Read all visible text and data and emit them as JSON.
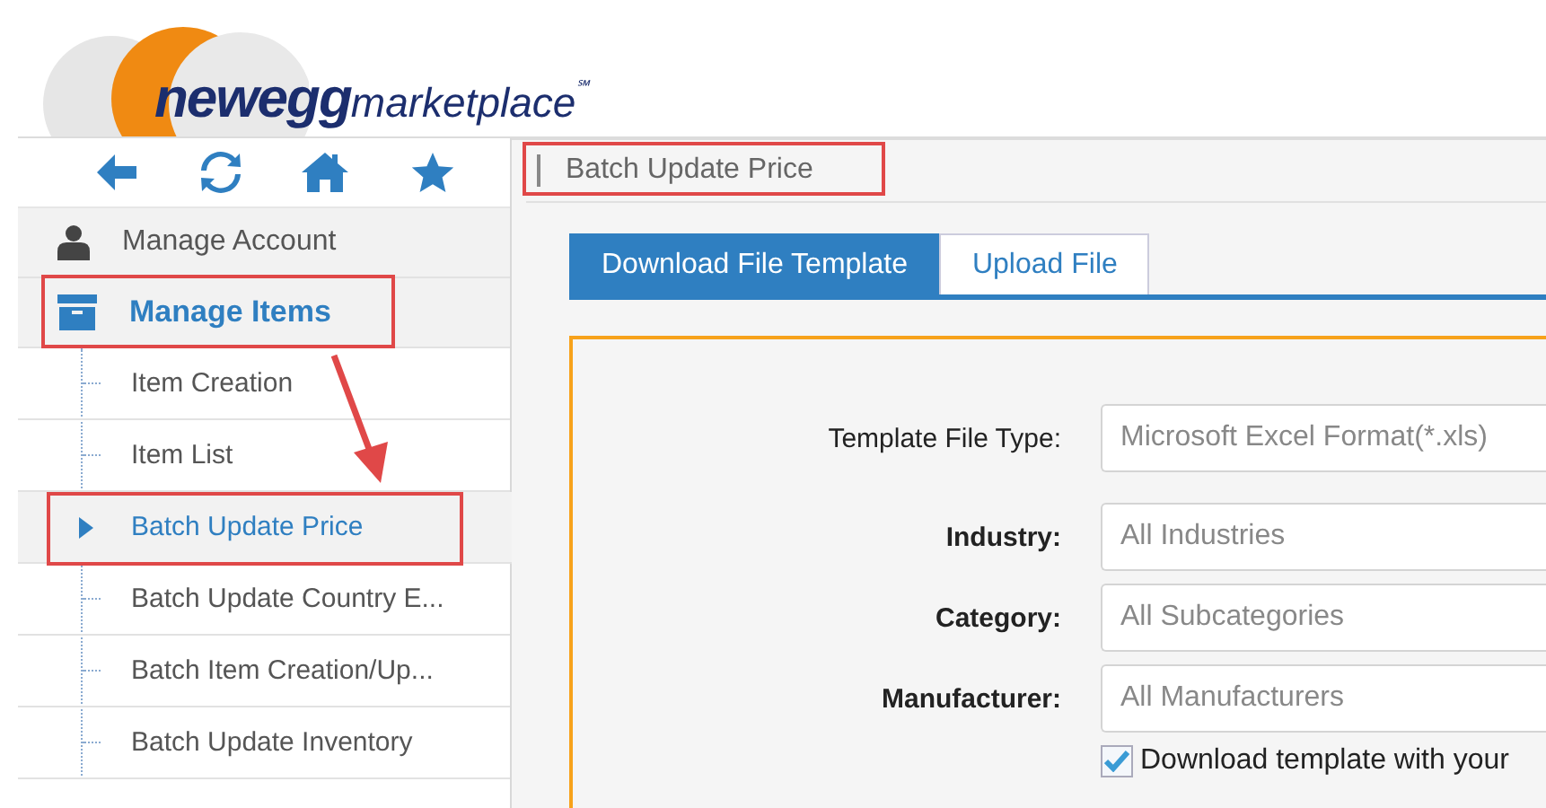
{
  "logo": {
    "brand": "newegg",
    "suffix": "marketplace",
    "mark": "℠"
  },
  "nav_icons": [
    {
      "kind": "back"
    },
    {
      "kind": "refresh"
    },
    {
      "kind": "home"
    },
    {
      "kind": "favorite"
    }
  ],
  "sidebar": {
    "items": [
      {
        "label": "Manage Account",
        "kind": "account",
        "expanded": false,
        "annotated": false
      },
      {
        "label": "Manage Items",
        "kind": "items",
        "expanded": true,
        "annotated": true,
        "children": [
          {
            "label": "Item Creation",
            "selected": false,
            "annotated": false
          },
          {
            "label": "Item List",
            "selected": false,
            "annotated": false
          },
          {
            "label": "Batch Update Price",
            "selected": true,
            "annotated": true
          },
          {
            "label": "Batch Update Country E...",
            "selected": false,
            "annotated": false
          },
          {
            "label": "Batch Item Creation/Up...",
            "selected": false,
            "annotated": false
          },
          {
            "label": "Batch Update Inventory",
            "selected": false,
            "annotated": false
          }
        ]
      }
    ]
  },
  "annotation_arrow": true,
  "breadcrumb": {
    "label": "Batch Update Price",
    "annotated": true
  },
  "tabs": [
    {
      "label": "Download File Template",
      "selected": true
    },
    {
      "label": "Upload File",
      "selected": false
    }
  ],
  "form": {
    "fields": [
      {
        "label": "Template File Type:",
        "value": "Microsoft Excel Format(*.xls)",
        "bold": false
      },
      {
        "label": "Industry:",
        "value": "All Industries",
        "bold": true
      },
      {
        "label": "Category:",
        "value": "All Subcategories",
        "bold": true
      },
      {
        "label": "Manufacturer:",
        "value": "All Manufacturers",
        "bold": true
      }
    ],
    "checkbox": {
      "label": "Download template with your",
      "checked": true
    }
  }
}
